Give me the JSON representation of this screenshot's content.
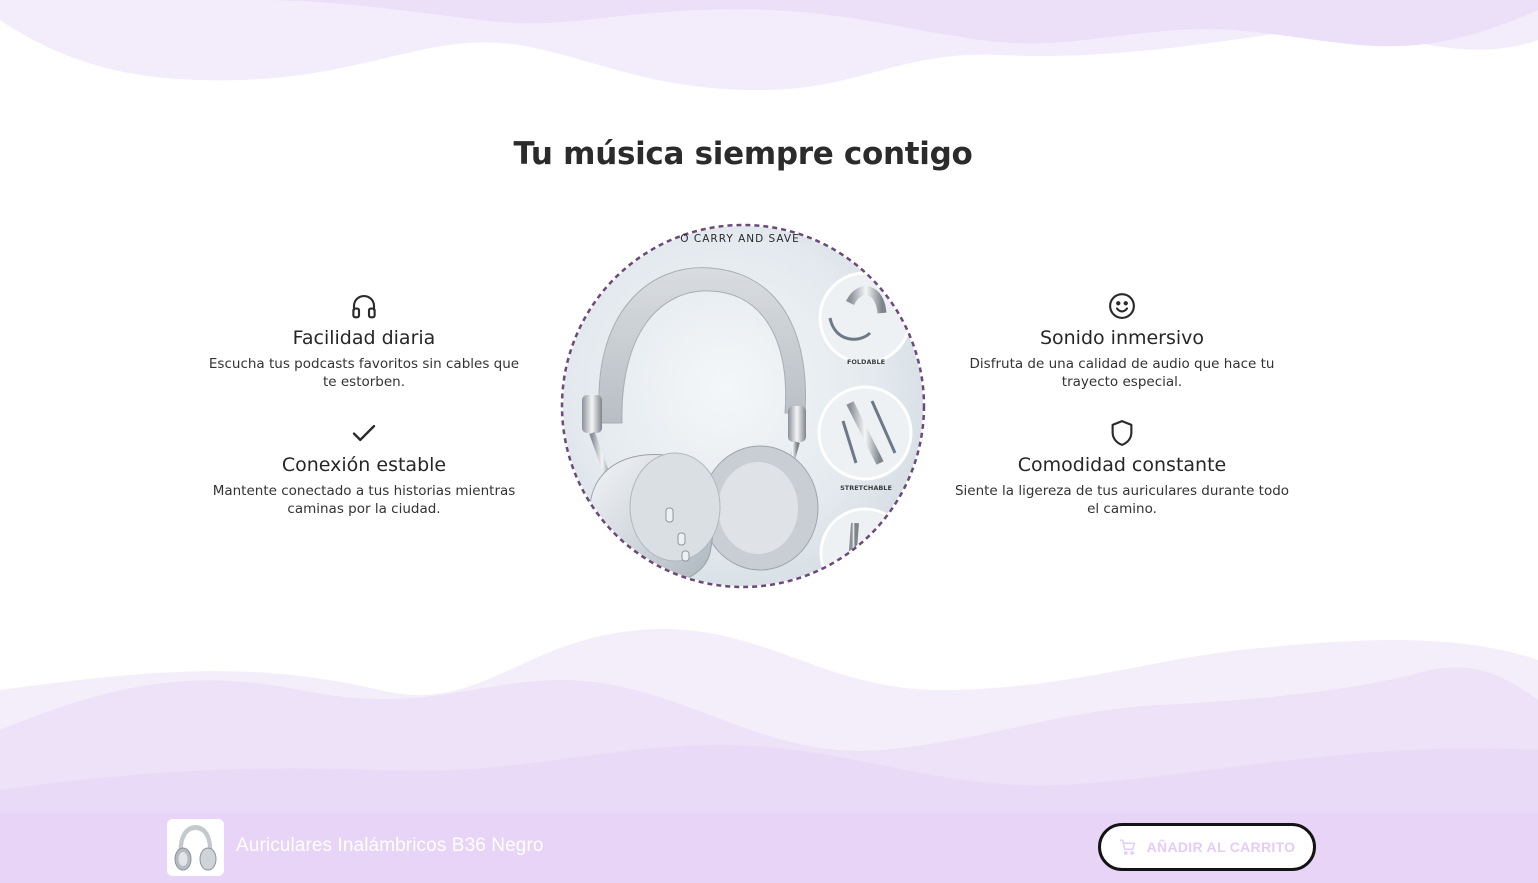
{
  "section": {
    "title": "Tu música siempre contigo"
  },
  "features": [
    {
      "icon": "headphones-icon",
      "title": "Facilidad diaria",
      "description": "Escucha tus podcasts favoritos sin cables que te estorben."
    },
    {
      "icon": "checkmark-icon",
      "title": "Conexión estable",
      "description": "Mantente conectado a tus historias mientras caminas por la ciudad."
    },
    {
      "icon": "smiley-icon",
      "title": "Sonido inmersivo",
      "description": "Disfruta de una calidad de audio que hace tu trayecto especial."
    },
    {
      "icon": "shield-icon",
      "title": "Comodidad constante",
      "description": "Siente la ligereza de tus auriculares durante todo el camino."
    }
  ],
  "product_image": {
    "banner_text": "O CARRY AND SAVE",
    "callouts": [
      "FOLDABLE",
      "STRETCHABLE"
    ]
  },
  "sticky_bar": {
    "product_name": "Auriculares Inalámbricos B36 Negro",
    "add_to_cart_label": "AÑADIR AL CARRITO"
  },
  "colors": {
    "accent_lavender": "#e8d4f7",
    "dashed_border": "#6b4a7a",
    "heading": "#2b2b2b"
  }
}
